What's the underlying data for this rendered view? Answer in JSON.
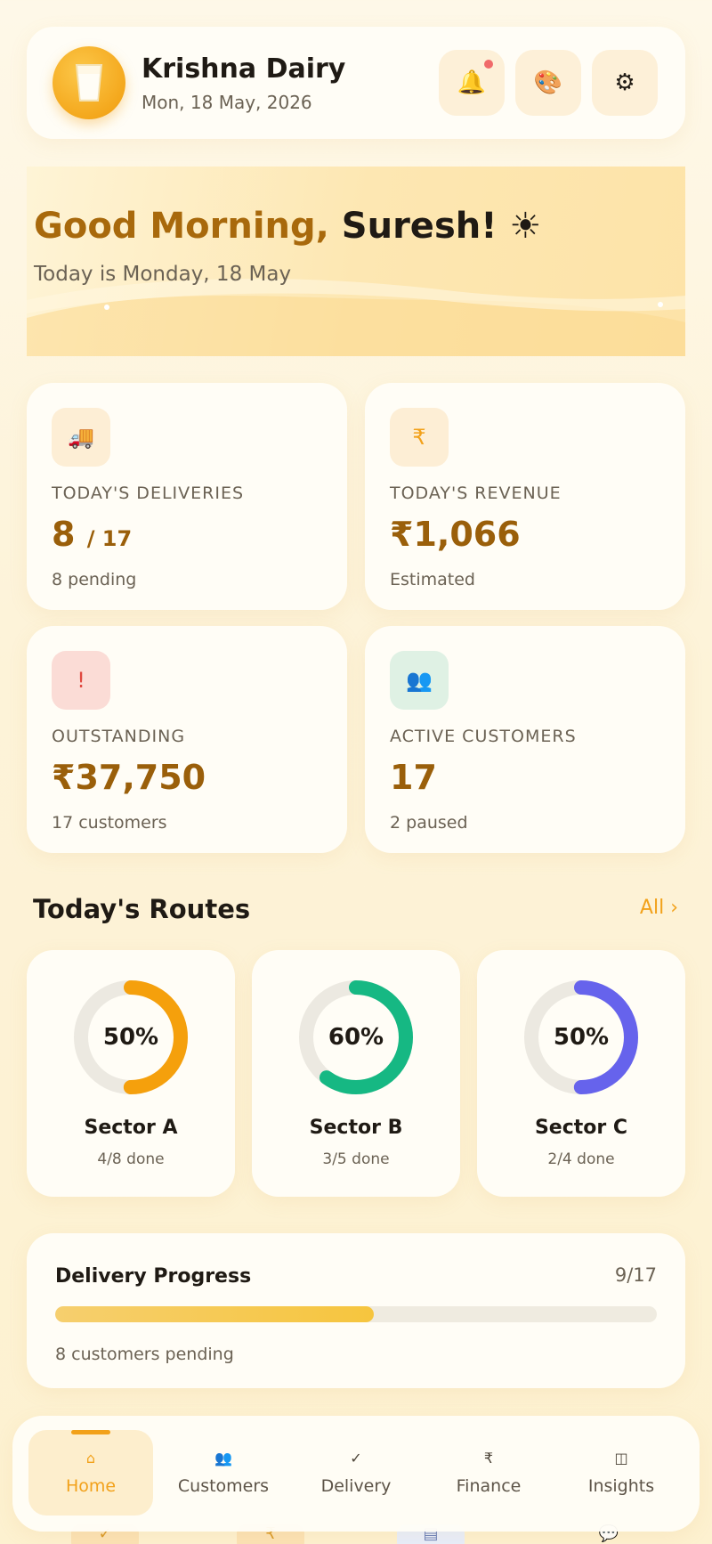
{
  "header": {
    "title": "Krishna Dairy",
    "date": "Mon, 18 May, 2026",
    "avatar_icon": "milk-glass-icon",
    "buttons": [
      {
        "name": "notification",
        "glyph": "🔔"
      },
      {
        "name": "theme",
        "glyph": "🎨"
      },
      {
        "name": "settings",
        "glyph": "⚙"
      }
    ]
  },
  "banner": {
    "greeting": "Good Morning,",
    "name": "Suresh!",
    "emoji": "☀",
    "subtitle": "Today is Monday, 18 May"
  },
  "stats": [
    {
      "icon": "🚚",
      "label": "TODAY'S DELIVERIES",
      "value": "8",
      "value_suffix": "/ 17",
      "sub": "8 pending",
      "icon_bg": "#fdeed5"
    },
    {
      "icon": "₹",
      "label": "TODAY'S REVENUE",
      "value": "₹1,066",
      "value_suffix": "",
      "sub": "Estimated",
      "icon_bg": "#fdeed5"
    },
    {
      "icon": "!",
      "label": "OUTSTANDING",
      "value": "₹37,750",
      "value_suffix": "",
      "sub": "17 customers",
      "icon_bg": "#fbdcd6"
    },
    {
      "icon": "👥",
      "label": "ACTIVE CUSTOMERS",
      "value": "17",
      "value_suffix": "",
      "sub": "2 paused",
      "icon_bg": "#dff1e4"
    }
  ],
  "routes_section": {
    "title": "Today's Routes",
    "link": "All ›"
  },
  "routes": [
    {
      "name": "Sector A",
      "percent_label": "50%",
      "fraction": 0.5,
      "done": "4/8 done",
      "color": "#f5a00c"
    },
    {
      "name": "Sector B",
      "percent_label": "60%",
      "fraction": 0.6,
      "done": "3/5 done",
      "color": "#16b883"
    },
    {
      "name": "Sector C",
      "percent_label": "50%",
      "fraction": 0.5,
      "done": "2/4 done",
      "color": "#6663ec"
    }
  ],
  "progress": {
    "title": "Delivery Progress",
    "count": "9/17",
    "fraction": 0.529,
    "sub": "8 customers pending"
  },
  "nav": {
    "items": [
      {
        "icon": "⌂",
        "label": "Home",
        "active": true
      },
      {
        "icon": "👥",
        "label": "Customers",
        "active": false
      },
      {
        "icon": "✓",
        "label": "Delivery",
        "active": false
      },
      {
        "icon": "₹",
        "label": "Finance",
        "active": false
      },
      {
        "icon": "◫",
        "label": "Insights",
        "active": false
      }
    ]
  },
  "peek_icons": [
    "✓",
    "₹",
    "▤",
    "💬"
  ]
}
